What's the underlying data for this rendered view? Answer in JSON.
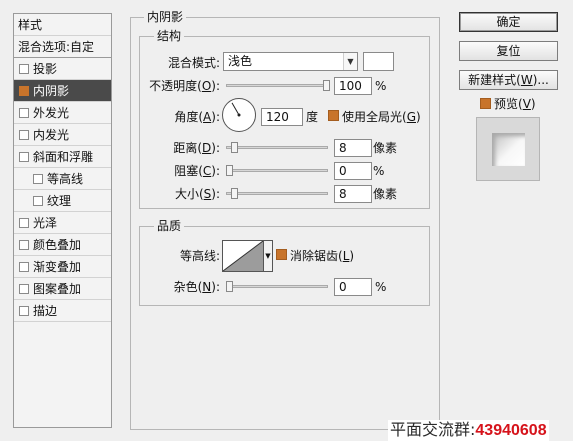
{
  "left_list": {
    "header": "样式",
    "blend_options": "混合选项:自定",
    "items": [
      {
        "label": "投影",
        "checked": false,
        "active": false,
        "sub": false
      },
      {
        "label": "内阴影",
        "checked": true,
        "active": true,
        "sub": false
      },
      {
        "label": "外发光",
        "checked": false,
        "active": false,
        "sub": false
      },
      {
        "label": "内发光",
        "checked": false,
        "active": false,
        "sub": false
      },
      {
        "label": "斜面和浮雕",
        "checked": false,
        "active": false,
        "sub": false
      },
      {
        "label": "等高线",
        "checked": false,
        "active": false,
        "sub": true
      },
      {
        "label": "纹理",
        "checked": false,
        "active": false,
        "sub": true
      },
      {
        "label": "光泽",
        "checked": false,
        "active": false,
        "sub": false
      },
      {
        "label": "颜色叠加",
        "checked": false,
        "active": false,
        "sub": false
      },
      {
        "label": "渐变叠加",
        "checked": false,
        "active": false,
        "sub": false
      },
      {
        "label": "图案叠加",
        "checked": false,
        "active": false,
        "sub": false
      },
      {
        "label": "描边",
        "checked": false,
        "active": false,
        "sub": false
      }
    ]
  },
  "panel": {
    "title": "内阴影",
    "structure": {
      "title": "结构",
      "blend_mode_label": "混合模式:",
      "blend_mode_value": "浅色",
      "swatch_color": "#ffffff",
      "opacity_label": "不透明度(",
      "opacity_key": "O",
      "opacity_value": "100",
      "opacity_fraction": 1.0,
      "percent": "%",
      "angle_label": "角度(",
      "angle_key": "A",
      "angle_value": "120",
      "angle_unit": "度",
      "global_light_label": "使用全局光(",
      "global_light_key": "G",
      "global_light_checked": true,
      "distance_label": "距离(",
      "distance_key": "D",
      "distance_value": "8",
      "distance_unit": "像素",
      "choke_label": "阻塞(",
      "choke_key": "C",
      "choke_value": "0",
      "size_label": "大小(",
      "size_key": "S",
      "size_value": "8",
      "size_unit": "像素"
    },
    "quality": {
      "title": "品质",
      "contour_label": "等高线:",
      "antialias_label": "消除锯齿(",
      "antialias_key": "L",
      "antialias_checked": true,
      "noise_label": "杂色(",
      "noise_key": "N",
      "noise_value": "0",
      "percent": "%"
    },
    "close_paren": "):"
  },
  "buttons": {
    "ok": "确定",
    "reset": "复位",
    "new_style": "新建样式(",
    "new_style_key": "W",
    "new_style_tail": ")...",
    "preview_label": "预览(",
    "preview_key": "V",
    "preview_checked": true
  },
  "watermark": {
    "prefix": "平面交流群:",
    "number": "43940608"
  },
  "colors": {
    "accent": "#c8742b",
    "active_row": "#4a4a4a",
    "background": "#efefef"
  }
}
